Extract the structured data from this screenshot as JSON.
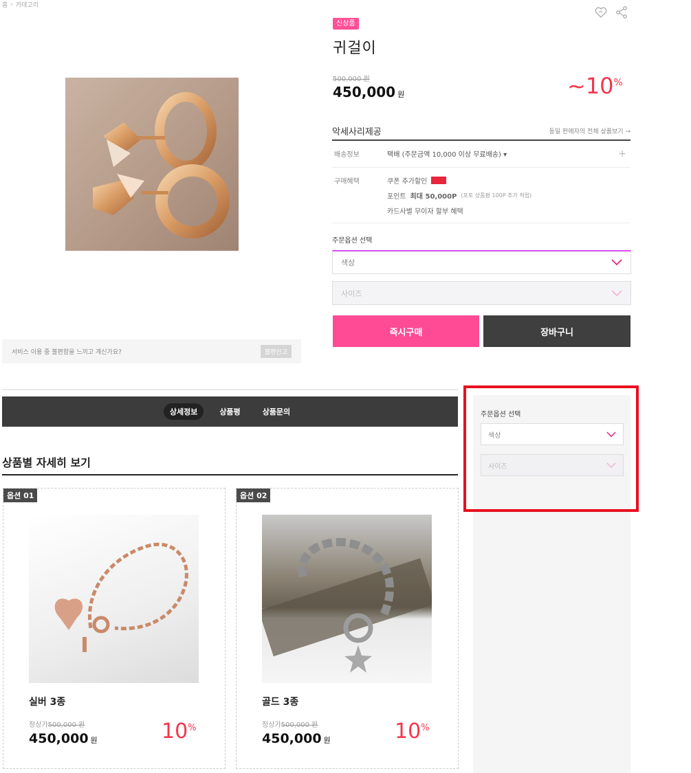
{
  "breadcrumb": {
    "home": "홈",
    "separator": "›",
    "category": "카테고리"
  },
  "product": {
    "badge": "신상품",
    "title": "귀걸이",
    "original_price": "500,000 원",
    "price": "450,000",
    "price_unit": "원",
    "discount": "~10",
    "discount_unit": "%"
  },
  "seller": {
    "name": "악세사리제공",
    "link": "동일 판매자의 전체 상품보기 →"
  },
  "shipping": {
    "label": "배송정보",
    "value": "택배 (주문금액 10,000 이상 무료배송) ▾",
    "plus": "+"
  },
  "benefits": {
    "label": "구매혜택",
    "coupon": "쿠폰 추가할인",
    "point_label": "포인트",
    "point_value": "최대 50,000P",
    "point_note": "(포토 상품평 100P 추가 적립)",
    "card": "카드사별 무이자 할부 혜택"
  },
  "options": {
    "title": "주문옵션 선택",
    "color_placeholder": "색상",
    "size_placeholder": "사이즈"
  },
  "actions": {
    "buy": "즉시구매",
    "cart": "장바구니"
  },
  "report": {
    "text": "서비스 이용 중 불편함을 느끼고 계신가요?",
    "button": "불편신고"
  },
  "tabs": [
    {
      "label": "상세정보"
    },
    {
      "label": "상품평"
    },
    {
      "label": "상품문의"
    }
  ],
  "details": {
    "title": "상품별 자세히 보기",
    "items": [
      {
        "badge": "옵션 01",
        "name": "실버 3종",
        "orig_label": "정상가",
        "orig_price": "500,000 원",
        "price": "450,000",
        "unit": "원",
        "discount": "10",
        "discount_unit": "%"
      },
      {
        "badge": "옵션 02",
        "name": "골드 3종",
        "orig_label": "정상가",
        "orig_price": "500,000 원",
        "price": "450,000",
        "unit": "원",
        "discount": "10",
        "discount_unit": "%"
      }
    ]
  },
  "sidebar": {
    "options_title": "주문옵션 선택",
    "color_placeholder": "색상",
    "size_placeholder": "사이즈"
  },
  "colors": {
    "accent_pink": "#ff4b96",
    "discount_red": "#f2374e",
    "highlight_red": "#e8101e",
    "dark": "#3c3c3c",
    "option_purple": "#d84ef0"
  }
}
